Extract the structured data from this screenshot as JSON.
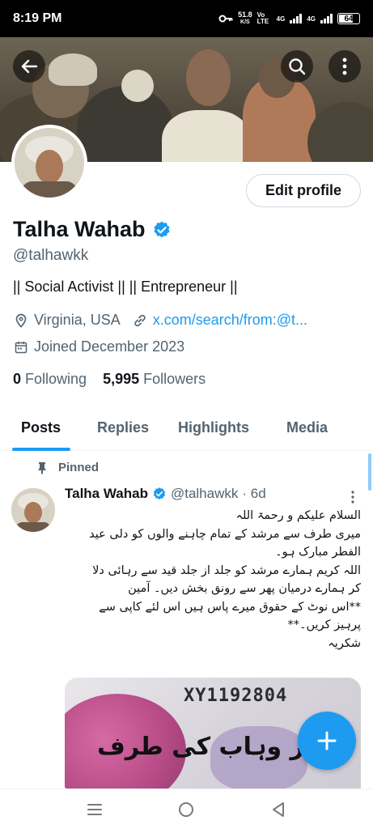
{
  "status_bar": {
    "time": "8:19 PM",
    "net_speed": "51.8",
    "net_unit": "K/S",
    "volte": "Vo LTE",
    "net1": "4G",
    "net2": "4G",
    "battery": "64"
  },
  "header": {
    "back_icon": "arrow-left-icon",
    "search_icon": "search-icon",
    "more_icon": "more-vertical-icon"
  },
  "profile": {
    "edit_label": "Edit profile",
    "name": "Talha Wahab",
    "handle": "@talhawkk",
    "bio": "|| Social Activist || || Entrepreneur ||",
    "location": "Virginia, USA",
    "link": "x.com/search/from:@t...",
    "joined": "Joined December 2023",
    "following_count": "0",
    "following_label": "Following",
    "followers_count": "5,995",
    "followers_label": "Followers"
  },
  "tabs": [
    {
      "label": "Posts",
      "active": true
    },
    {
      "label": "Replies",
      "active": false
    },
    {
      "label": "Highlights",
      "active": false
    },
    {
      "label": "Media",
      "active": false
    }
  ],
  "post": {
    "pinned_label": "Pinned",
    "author": "Talha Wahab",
    "handle": "@talhawkk",
    "time": "· 6d",
    "lines": [
      "السلام علیکم و رحمۃ اللہ",
      "میری طرف سے مرشد کے تمام چاہنے والوں کو دلی عید",
      "الفطر مبارک ہو۔",
      "اللہ کریم ہمارے مرشد کو جلد از جلد قید سے رہائی دلا",
      "کر ہمارے درمیان پھر سے رونق بخش دیں۔ آمین",
      "**اس نوٹ کے حقوق میرے پاس ہیں اس لئے کاپی سے",
      "پرہیز کریں۔**",
      "شکریہ"
    ],
    "media_serial": "XY1192804",
    "media_text": "عمر وہاب کی طرف"
  },
  "colors": {
    "accent": "#1d9bf0",
    "text": "#0f1419",
    "muted": "#536471"
  }
}
